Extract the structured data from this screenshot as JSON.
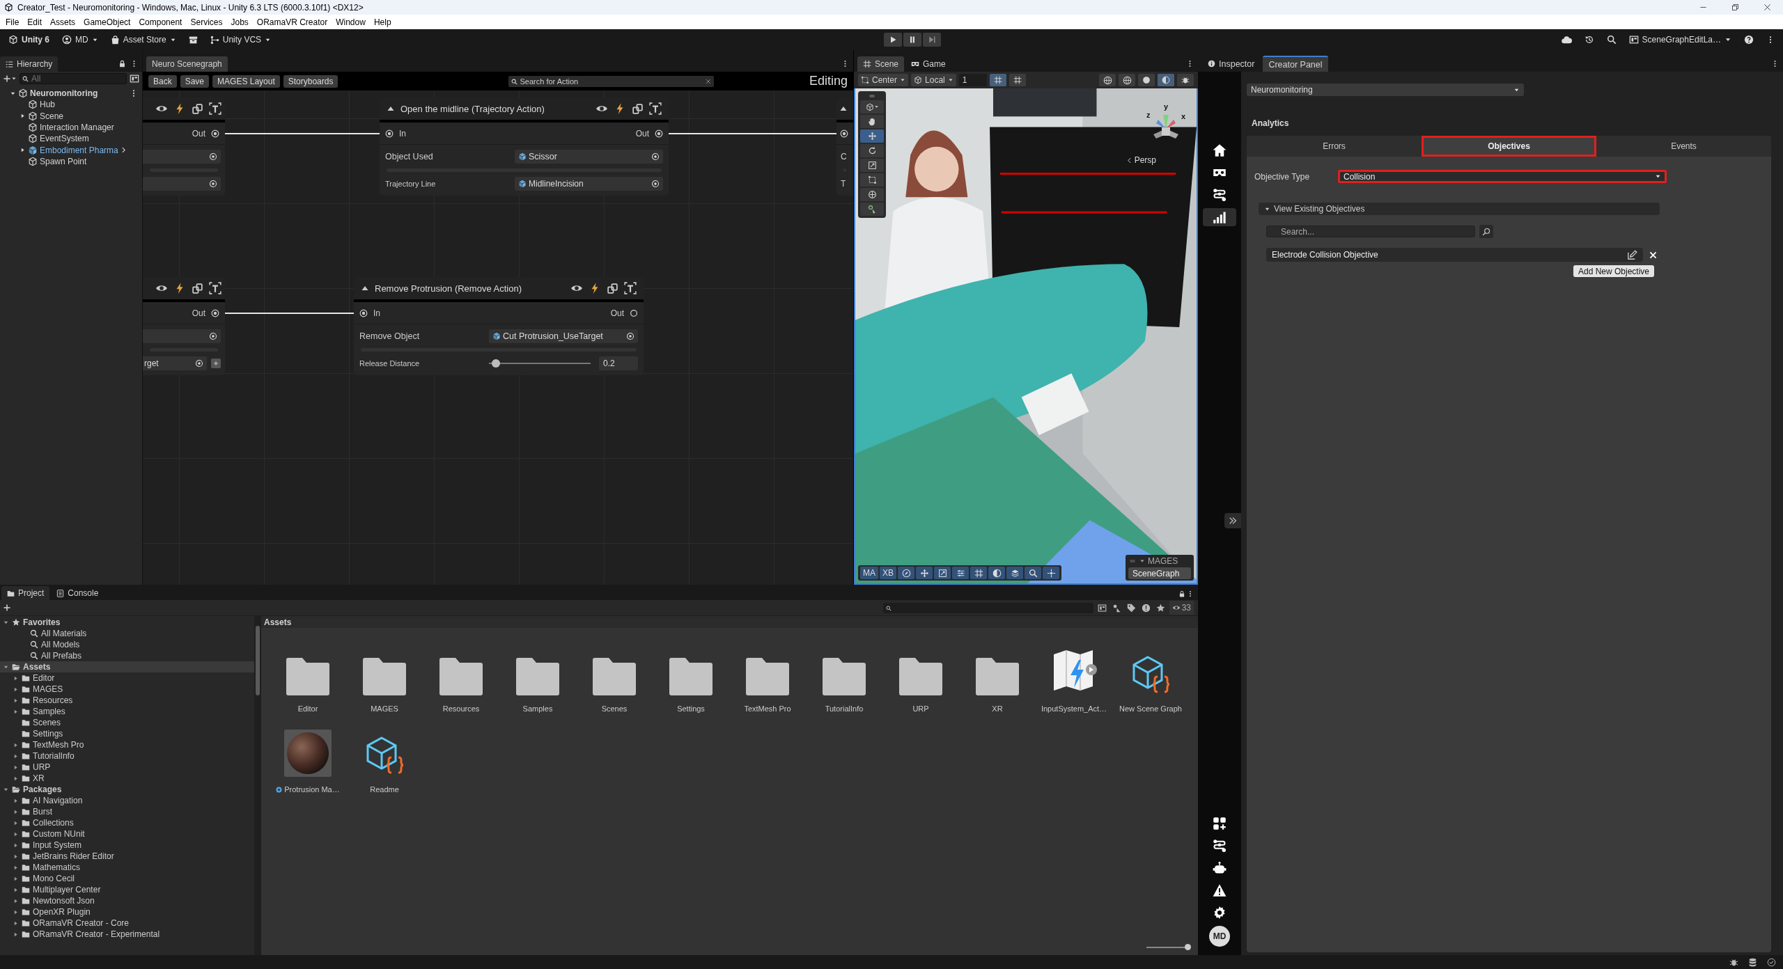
{
  "window": {
    "title": "Creator_Test - Neuromonitoring - Windows, Mac, Linux - Unity 6.3 LTS (6000.3.10f1) <DX12>"
  },
  "menu": [
    "File",
    "Edit",
    "Assets",
    "GameObject",
    "Component",
    "Services",
    "Jobs",
    "ORamaVR Creator",
    "Window",
    "Help"
  ],
  "toolbar": {
    "product": "Unity 6",
    "account": "MD",
    "store": "Asset Store",
    "vcs": "Unity VCS",
    "layout": "SceneGraphEditLa…"
  },
  "hierarchy": {
    "tab": "Hierarchy",
    "search": {
      "placeholder": "All"
    },
    "items": [
      {
        "label": "Neuromonitoring",
        "kind": "scene",
        "expanded": true,
        "children": [
          {
            "label": "Hub",
            "kind": "object"
          },
          {
            "label": "Scene",
            "kind": "object",
            "expanded": false
          },
          {
            "label": "Interaction Manager",
            "kind": "object"
          },
          {
            "label": "EventSystem",
            "kind": "object"
          },
          {
            "label": "Embodiment Pharma",
            "kind": "prefab",
            "expanded": false
          },
          {
            "label": "Spawn Point",
            "kind": "object"
          }
        ]
      }
    ]
  },
  "scenegraph": {
    "tab": "Neuro Scenegraph",
    "buttons": [
      "Back",
      "Save",
      "MAGES Layout",
      "Storyboards"
    ],
    "search": {
      "placeholder": "Search for Action"
    },
    "mode": "Editing",
    "nodes": [
      {
        "kind": "cut_left",
        "out": "Out",
        "out_connected": true,
        "fields": [
          {
            "kind": "object"
          },
          {
            "kind": "object"
          }
        ]
      },
      {
        "kind": "full",
        "title": "Open the midline (Trajectory Action)",
        "in": "In",
        "out": "Out",
        "out_connected": true,
        "fields": [
          {
            "kind": "object",
            "label": "Object Used",
            "value": "Scissor"
          },
          {
            "kind": "object",
            "label": "Trajectory Line",
            "value": "MidlineIncision"
          }
        ]
      },
      {
        "kind": "cut_right",
        "fields": [
          {
            "label": "C"
          },
          {
            "label": "T"
          }
        ]
      },
      {
        "kind": "cut_left",
        "out": "Out",
        "out_connected": true,
        "fields": [
          {
            "kind": "object"
          },
          {
            "kind": "object_add",
            "value": "rget"
          }
        ]
      },
      {
        "kind": "full",
        "title": "Remove Protrusion (Remove Action)",
        "in": "In",
        "out": "Out",
        "out_connected": false,
        "fields": [
          {
            "kind": "object",
            "label": "Remove Object",
            "value": "Cut Protrusion_UseTarget"
          },
          {
            "kind": "slider",
            "label": "Release Distance",
            "level": 0.07,
            "value": "0.2"
          }
        ]
      }
    ]
  },
  "scene_view": {
    "tabs": [
      {
        "label": "Scene",
        "selected": true
      },
      {
        "label": "Game",
        "selected": false
      }
    ],
    "pivot": "Center",
    "space": "Local",
    "grid_size": "1",
    "camera": "Persp",
    "gizmo_axes": [
      "y",
      "z",
      "x"
    ],
    "tools": [
      {
        "kind": "hand",
        "selected": false
      },
      {
        "kind": "move",
        "selected": true
      },
      {
        "kind": "rotate",
        "selected": false
      },
      {
        "kind": "scale",
        "selected": false
      },
      {
        "kind": "rect",
        "selected": false
      },
      {
        "kind": "transform",
        "selected": false
      },
      {
        "kind": "custom",
        "selected": false
      }
    ],
    "overlay": {
      "title": "MAGES",
      "buttons": [
        "MA",
        "XB"
      ],
      "scenegraph": "SceneGraph"
    }
  },
  "creator": {
    "tabs": [
      {
        "label": "Inspector",
        "selected": false
      },
      {
        "label": "Creator Panel",
        "selected": true
      }
    ],
    "nav": [
      {
        "kind": "home",
        "selected": false
      },
      {
        "kind": "vr",
        "selected": false
      },
      {
        "kind": "flow",
        "selected": false
      },
      {
        "kind": "chart",
        "selected": true
      }
    ],
    "nav_bottom": [
      {
        "kind": "apps"
      },
      {
        "kind": "flow"
      },
      {
        "kind": "robot"
      },
      {
        "kind": "warning"
      },
      {
        "kind": "settings"
      }
    ],
    "avatar": "MD",
    "scene_dropdown": "Neuromonitoring",
    "section": "Analytics",
    "subtabs": [
      {
        "label": "Errors",
        "selected": false,
        "highlighted": false
      },
      {
        "label": "Objectives",
        "selected": true,
        "highlighted": true
      },
      {
        "label": "Events",
        "selected": false,
        "highlighted": false
      }
    ],
    "objective_type": {
      "label": "Objective Type",
      "value": "Collision",
      "highlighted": true
    },
    "foldout": {
      "label": "View Existing Objectives",
      "expanded": true
    },
    "search": {
      "placeholder": "Search..."
    },
    "objectives": [
      "Electrode Collision Objective"
    ],
    "add_button": "Add New Objective"
  },
  "project": {
    "zoom_slider": {
      "level": 1
    },
    "tabs": [
      {
        "label": "Project",
        "selected": true
      },
      {
        "label": "Console",
        "selected": false
      }
    ],
    "hidden_count": "33",
    "breadcrumb": "Assets",
    "tree": [
      {
        "label": "Favorites",
        "kind": "favorites",
        "selected": false,
        "expanded": true,
        "children": [
          {
            "label": "All Materials",
            "kind": "search"
          },
          {
            "label": "All Models",
            "kind": "search"
          },
          {
            "label": "All Prefabs",
            "kind": "search"
          }
        ]
      },
      {
        "label": "Assets",
        "kind": "root",
        "selected": true,
        "expanded": true,
        "children": [
          {
            "label": "Editor",
            "kind": "folder",
            "expanded": false
          },
          {
            "label": "MAGES",
            "kind": "folder",
            "expanded": false
          },
          {
            "label": "Resources",
            "kind": "folder",
            "expanded": false
          },
          {
            "label": "Samples",
            "kind": "folder",
            "expanded": false
          },
          {
            "label": "Scenes",
            "kind": "folder"
          },
          {
            "label": "Settings",
            "kind": "folder"
          },
          {
            "label": "TextMesh Pro",
            "kind": "folder",
            "expanded": false
          },
          {
            "label": "TutorialInfo",
            "kind": "folder",
            "expanded": false
          },
          {
            "label": "URP",
            "kind": "folder",
            "expanded": false
          },
          {
            "label": "XR",
            "kind": "folder",
            "expanded": false
          }
        ]
      },
      {
        "label": "Packages",
        "kind": "root",
        "selected": false,
        "expanded": true,
        "children": [
          {
            "label": "AI Navigation",
            "kind": "folder",
            "expanded": false
          },
          {
            "label": "Burst",
            "kind": "folder",
            "expanded": false
          },
          {
            "label": "Collections",
            "kind": "folder",
            "expanded": false
          },
          {
            "label": "Custom NUnit",
            "kind": "folder",
            "expanded": false
          },
          {
            "label": "Input System",
            "kind": "folder",
            "expanded": false
          },
          {
            "label": "JetBrains Rider Editor",
            "kind": "folder",
            "expanded": false
          },
          {
            "label": "Mathematics",
            "kind": "folder",
            "expanded": false
          },
          {
            "label": "Mono Cecil",
            "kind": "folder",
            "expanded": false
          },
          {
            "label": "Multiplayer Center",
            "kind": "folder",
            "expanded": false
          },
          {
            "label": "Newtonsoft Json",
            "kind": "folder",
            "expanded": false
          },
          {
            "label": "OpenXR Plugin",
            "kind": "folder",
            "expanded": false
          },
          {
            "label": "ORamaVR Creator - Core",
            "kind": "folder",
            "expanded": false
          },
          {
            "label": "ORamaVR Creator - Experimental",
            "kind": "folder",
            "expanded": false
          }
        ]
      }
    ],
    "assets": [
      {
        "label": "Editor",
        "kind": "folder"
      },
      {
        "label": "MAGES",
        "kind": "folder"
      },
      {
        "label": "Resources",
        "kind": "folder"
      },
      {
        "label": "Samples",
        "kind": "folder"
      },
      {
        "label": "Scenes",
        "kind": "folder"
      },
      {
        "label": "Settings",
        "kind": "folder"
      },
      {
        "label": "TextMesh Pro",
        "kind": "folder"
      },
      {
        "label": "TutorialInfo",
        "kind": "folder"
      },
      {
        "label": "URP",
        "kind": "folder"
      },
      {
        "label": "XR",
        "kind": "folder"
      },
      {
        "label": "InputSystem_Act…",
        "kind": "input_actions"
      },
      {
        "label": "New Scene Graph",
        "kind": "scene_graph"
      },
      {
        "label": "Protrusion Ma…",
        "kind": "material"
      },
      {
        "label": "Readme",
        "kind": "scene_graph"
      }
    ]
  }
}
